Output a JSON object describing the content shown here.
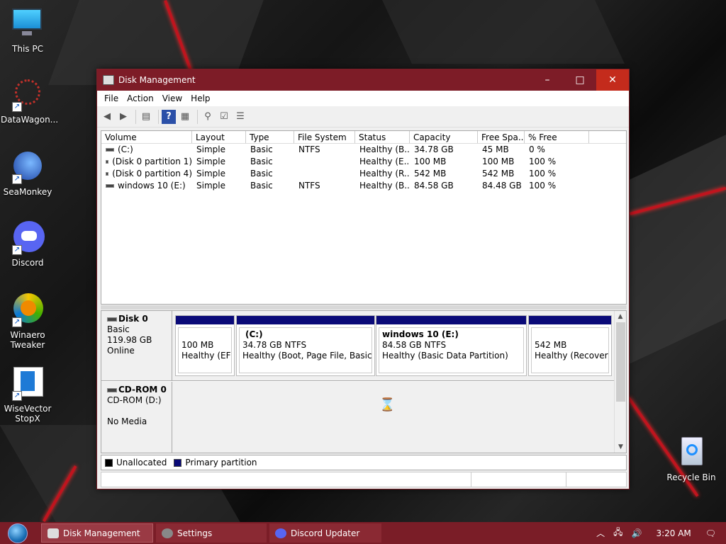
{
  "desktop": {
    "icons": [
      {
        "label": "This PC"
      },
      {
        "label": "DataWagon..."
      },
      {
        "label": "SeaMonkey"
      },
      {
        "label": "Discord"
      },
      {
        "label": "Winaero Tweaker"
      },
      {
        "label": "WiseVector StopX"
      },
      {
        "label": "Recycle Bin"
      }
    ]
  },
  "window": {
    "title": "Disk Management",
    "minimize": "–",
    "maximize": "□",
    "close": "✕",
    "menu": [
      "File",
      "Action",
      "View",
      "Help"
    ],
    "volume_table": {
      "headers": [
        "Volume",
        "Layout",
        "Type",
        "File System",
        "Status",
        "Capacity",
        "Free Spa...",
        "% Free"
      ],
      "rows": [
        [
          "(C:)",
          "Simple",
          "Basic",
          "NTFS",
          "Healthy (B...",
          "34.78 GB",
          "45 MB",
          "0 %"
        ],
        [
          "(Disk 0 partition 1)",
          "Simple",
          "Basic",
          "",
          "Healthy (E...",
          "100 MB",
          "100 MB",
          "100 %"
        ],
        [
          "(Disk 0 partition 4)",
          "Simple",
          "Basic",
          "",
          "Healthy (R...",
          "542 MB",
          "542 MB",
          "100 %"
        ],
        [
          "windows 10 (E:)",
          "Simple",
          "Basic",
          "NTFS",
          "Healthy (B...",
          "84.58 GB",
          "84.48 GB",
          "100 %"
        ]
      ]
    },
    "disks": [
      {
        "name": "Disk 0",
        "type": "Basic",
        "size": "119.98 GB",
        "state": "Online",
        "partitions": [
          {
            "name": "",
            "size": "100 MB",
            "status": "Healthy (EFI S"
          },
          {
            "name": "(C:)",
            "size": "34.78 GB NTFS",
            "status": "Healthy (Boot, Page File, Basic Dat"
          },
          {
            "name": "windows 10  (E:)",
            "size": "84.58 GB NTFS",
            "status": "Healthy (Basic Data Partition)"
          },
          {
            "name": "",
            "size": "542 MB",
            "status": "Healthy (Recovery P"
          }
        ]
      },
      {
        "name": "CD-ROM 0",
        "type": "CD-ROM (D:)",
        "size": "",
        "state": "No Media",
        "partitions": []
      }
    ],
    "legend": [
      {
        "label": "Unallocated",
        "color": "#000000"
      },
      {
        "label": "Primary partition",
        "color": "#0a0a78"
      }
    ]
  },
  "taskbar": {
    "buttons": [
      {
        "label": "Disk Management"
      },
      {
        "label": "Settings"
      },
      {
        "label": "Discord Updater"
      }
    ],
    "time": "3:20 AM"
  },
  "colors": {
    "accent": "#7d1c27",
    "partition_bar": "#0a0a78"
  }
}
